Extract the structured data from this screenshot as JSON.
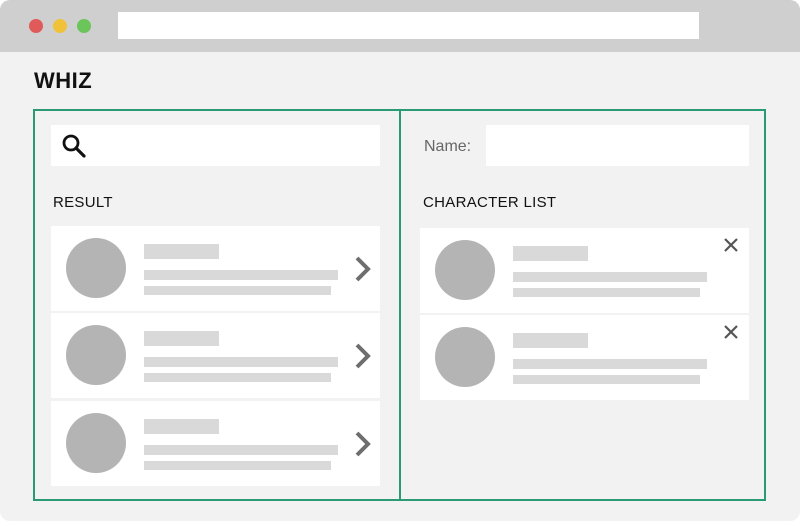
{
  "app": {
    "title": "WHIZ"
  },
  "search": {
    "placeholder": ""
  },
  "result": {
    "heading": "RESULT",
    "items": [
      {},
      {},
      {}
    ]
  },
  "character_list": {
    "name_label": "Name:",
    "name_value": "",
    "heading": "CHARACTER LIST",
    "items": [
      {},
      {}
    ]
  },
  "colors": {
    "accent_border": "#2a9a76",
    "avatar": "#b4b4b4",
    "placeholder_bar": "#d9d9d9",
    "window_bg": "#f2f2f2",
    "titlebar": "#cfcfcf"
  },
  "icons": {
    "search": "search-icon",
    "row_action": "chevron-right-icon",
    "remove": "close-icon"
  }
}
